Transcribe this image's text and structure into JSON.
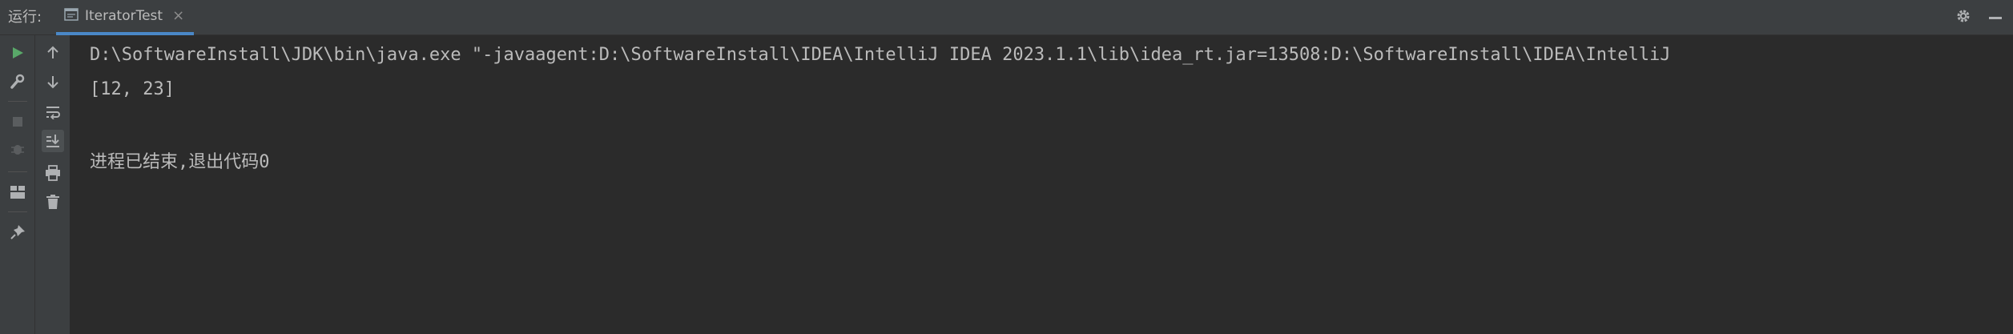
{
  "header": {
    "run_label": "运行:",
    "tab_label": "IteratorTest",
    "tab_close": "×"
  },
  "console": {
    "lines": [
      "D:\\SoftwareInstall\\JDK\\bin\\java.exe \"-javaagent:D:\\SoftwareInstall\\IDEA\\IntelliJ IDEA 2023.1.1\\lib\\idea_rt.jar=13508:D:\\SoftwareInstall\\IDEA\\IntelliJ",
      "[12, 23]",
      "进程已结束,退出代码0"
    ]
  },
  "icons": {
    "run": "run-icon",
    "wrench": "wrench-icon",
    "stop": "stop-icon",
    "debug": "debug-icon",
    "layout": "layout-icon",
    "pin": "pin-icon",
    "up": "arrow-up-icon",
    "down": "arrow-down-icon",
    "soft_wrap": "soft-wrap-icon",
    "scroll_to_end": "scroll-to-end-icon",
    "print": "print-icon",
    "trash": "trash-icon",
    "gear": "gear-icon",
    "minimize": "minimize-icon"
  },
  "colors": {
    "background": "#2b2b2b",
    "panel": "#3c3f41",
    "text": "#bbbbbb",
    "run_green": "#59a869",
    "tab_underline": "#4a88c7"
  }
}
